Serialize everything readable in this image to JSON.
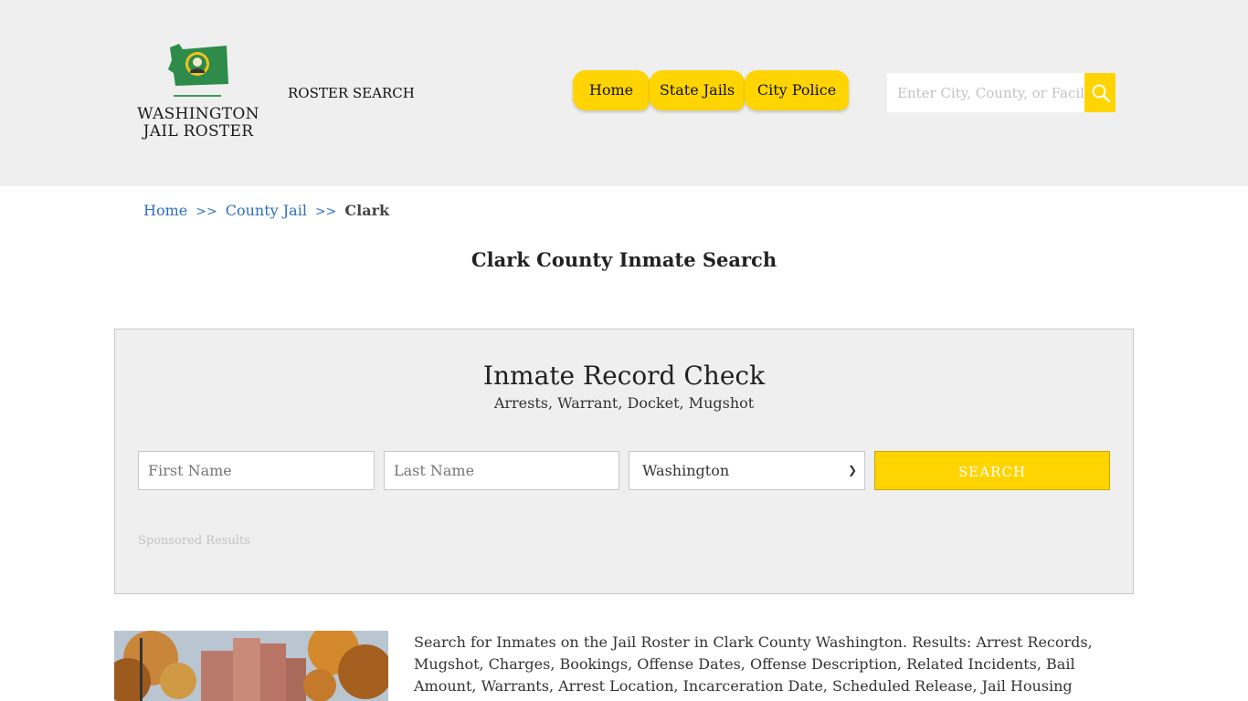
{
  "header": {
    "logo": {
      "line1": "WASHINGTON",
      "line2": "JAIL ROSTER"
    },
    "roster_search": "ROSTER SEARCH",
    "nav": [
      {
        "label": "Home"
      },
      {
        "label": "State Jails"
      },
      {
        "label": "City Police"
      }
    ],
    "search": {
      "placeholder": "Enter City, County, or Facility"
    },
    "colors": {
      "accent": "#ffd400",
      "header_bg": "#efefef"
    }
  },
  "breadcrumb": {
    "items": [
      "Home",
      "County Jail",
      "Clark"
    ],
    "separator": ">>"
  },
  "page_title": "Clark County Inmate Search",
  "record_check": {
    "title": "Inmate Record Check",
    "subtitle": "Arrests, Warrant, Docket, Mugshot",
    "first_name_placeholder": "First Name",
    "last_name_placeholder": "Last Name",
    "state_selected": "Washington",
    "search_label": "SEARCH",
    "sponsored": "Sponsored Results"
  },
  "description": "Search for Inmates on the Jail Roster in Clark County Washington. Results: Arrest Records, Mugshot, Charges, Bookings, Offense Dates, Offense Description, Related Incidents, Bail Amount, Warrants, Arrest Location, Incarceration Date, Scheduled Release, Jail Housing Location, Court."
}
